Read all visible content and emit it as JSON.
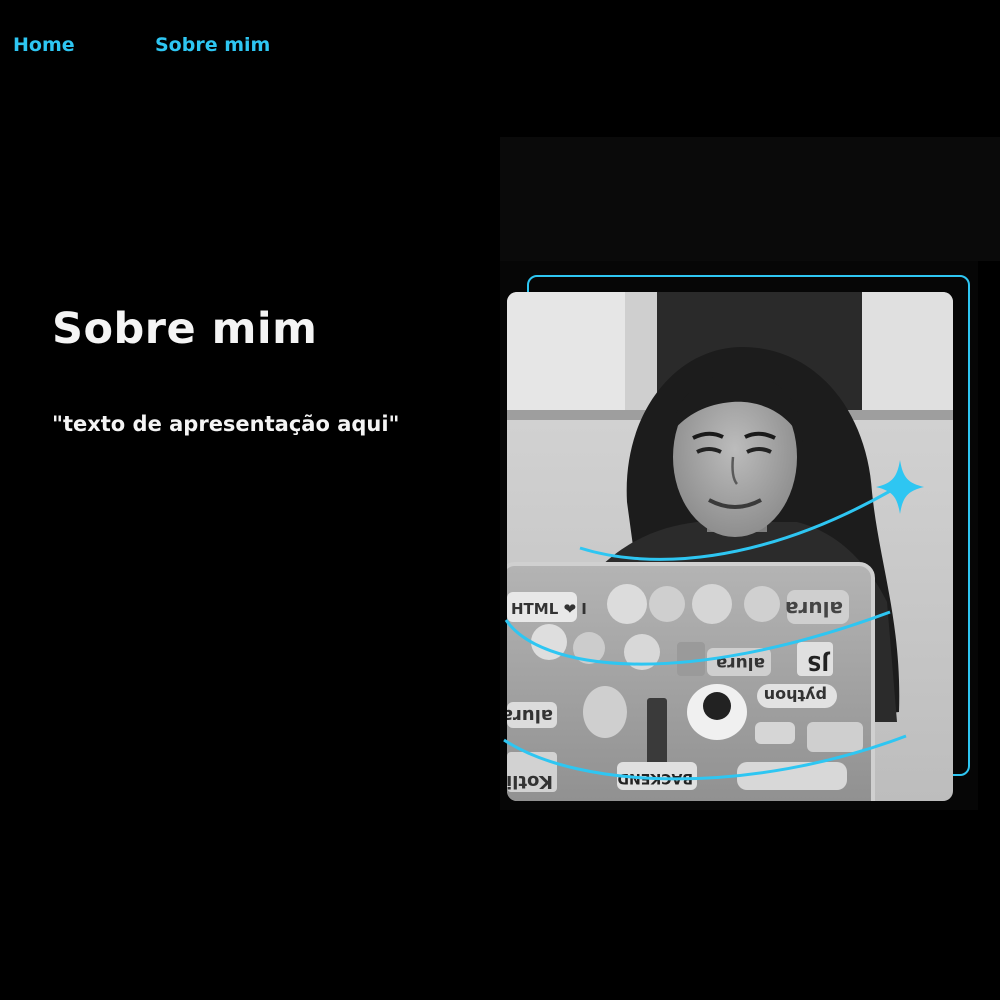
{
  "nav": {
    "items": [
      {
        "label": "Home"
      },
      {
        "label": "Sobre mim"
      }
    ]
  },
  "hero": {
    "title": "Sobre mim",
    "text": "\"texto de apresentação aqui\""
  },
  "photo": {
    "sticker_labels": [
      "HTML ❤ I",
      "alura",
      "JS",
      "python",
      "alura",
      "BACKEND",
      "alura",
      "Kotlin"
    ]
  },
  "colors": {
    "accent": "#2ec6f2",
    "background": "#000000",
    "text": "#f4f4f4"
  },
  "icons": [
    "sparkle-icon"
  ]
}
